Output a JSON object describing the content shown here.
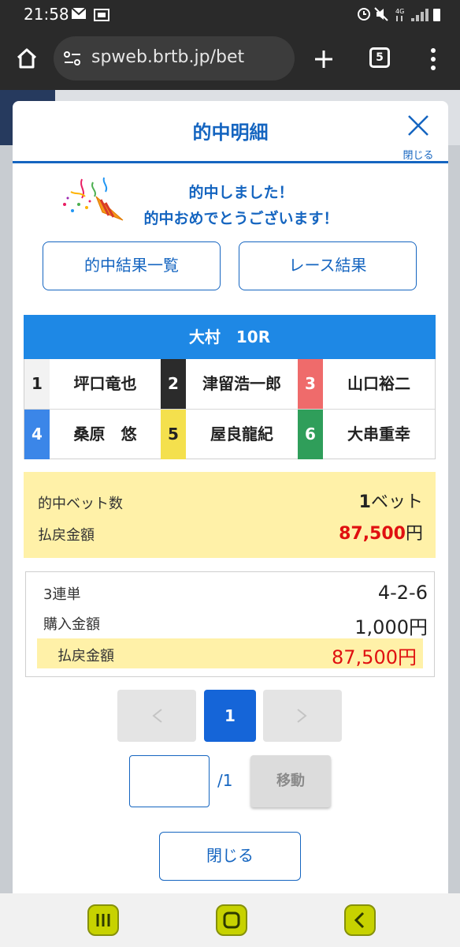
{
  "status_bar": {
    "time": "21:58"
  },
  "browser": {
    "url": "spweb.brtb.jp/bet",
    "tab_count": "5"
  },
  "modal": {
    "title": "的中明細",
    "close_label": "閉じる",
    "congrats_line1": "的中しました！",
    "congrats_line2": "的中おめでとうございます！",
    "buttons": {
      "hit_list": "的中結果一覧",
      "race_result": "レース結果"
    },
    "race_header": "大村　10R",
    "racers": [
      {
        "num": "1",
        "name": "坪口竜也",
        "color": "#f2f2f2",
        "text_color": "#222222"
      },
      {
        "num": "2",
        "name": "津留浩一郎",
        "color": "#2b2b2b",
        "text_color": "#ffffff"
      },
      {
        "num": "3",
        "name": "山口裕二",
        "color": "#ef6b6b",
        "text_color": "#ffffff"
      },
      {
        "num": "4",
        "name": "桑原　悠",
        "color": "#3b86e8",
        "text_color": "#ffffff"
      },
      {
        "num": "5",
        "name": "屋良龍紀",
        "color": "#f4e04d",
        "text_color": "#222222"
      },
      {
        "num": "6",
        "name": "大串重幸",
        "color": "#2f9e5a",
        "text_color": "#ffffff"
      }
    ],
    "summary": {
      "hit_bets_label": "的中ベット数",
      "hit_bets_value": "1",
      "hit_bets_unit": "ベット",
      "payout_label": "払戻金額",
      "payout_value": "87,500",
      "payout_unit": "円"
    },
    "detail": {
      "bet_type": "3連単",
      "combination": "4-2-6",
      "purchase_label": "購入金額",
      "purchase_value": "1,000円",
      "payout_label": "払戻金額",
      "payout_value": "87,500円"
    },
    "pagination": {
      "current": "1",
      "input_value": "",
      "total": "/1",
      "move_label": "移動"
    },
    "bottom_close": "閉じる"
  },
  "colors": {
    "accent": "#1565c0",
    "race_header": "#1e88e5",
    "highlight": "#fff1a8",
    "payout_red": "#e01010"
  }
}
